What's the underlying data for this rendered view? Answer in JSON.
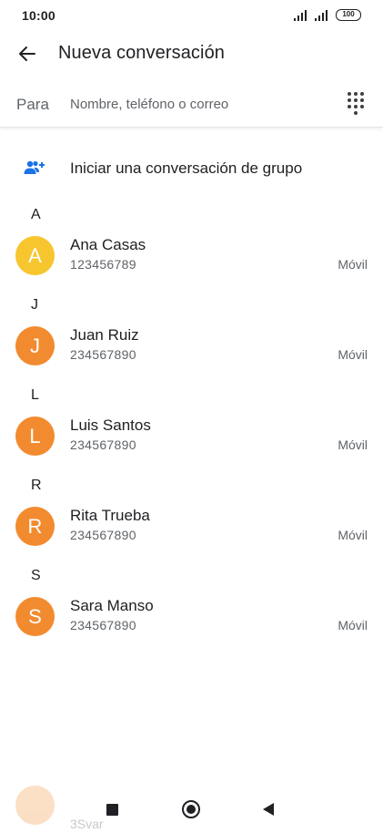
{
  "status_bar": {
    "time": "10:00",
    "battery": "100"
  },
  "header": {
    "title": "Nueva conversación",
    "back_icon": "arrow-left-icon"
  },
  "to_field": {
    "label": "Para",
    "placeholder": "Nombre, teléfono o correo",
    "value": "",
    "dialpad_icon": "dialpad-icon"
  },
  "group": {
    "label": "Iniciar una conversación de grupo",
    "icon": "group-add-icon",
    "accent": "#1a73e8"
  },
  "sections": [
    {
      "letter": "A",
      "contacts": [
        {
          "initial": "A",
          "name": "Ana Casas",
          "phone": "123456789",
          "type": "Móvil",
          "color": "#f7c52e"
        }
      ]
    },
    {
      "letter": "J",
      "contacts": [
        {
          "initial": "J",
          "name": "Juan Ruiz",
          "phone": "234567890",
          "type": "Móvil",
          "color": "#f28b2f"
        }
      ]
    },
    {
      "letter": "L",
      "contacts": [
        {
          "initial": "L",
          "name": "Luis Santos",
          "phone": "234567890",
          "type": "Móvil",
          "color": "#f28b2f"
        }
      ]
    },
    {
      "letter": "R",
      "contacts": [
        {
          "initial": "R",
          "name": "Rita Trueba",
          "phone": "234567890",
          "type": "Móvil",
          "color": "#f28b2f"
        }
      ]
    },
    {
      "letter": "S",
      "contacts": [
        {
          "initial": "S",
          "name": "Sara Manso",
          "phone": "234567890",
          "type": "Móvil",
          "color": "#f28b2f"
        }
      ]
    }
  ],
  "faded_item": {
    "text": "3Svar"
  },
  "nav": {
    "recent_icon": "square-icon",
    "home_icon": "circle-icon",
    "back_icon": "triangle-back-icon"
  }
}
